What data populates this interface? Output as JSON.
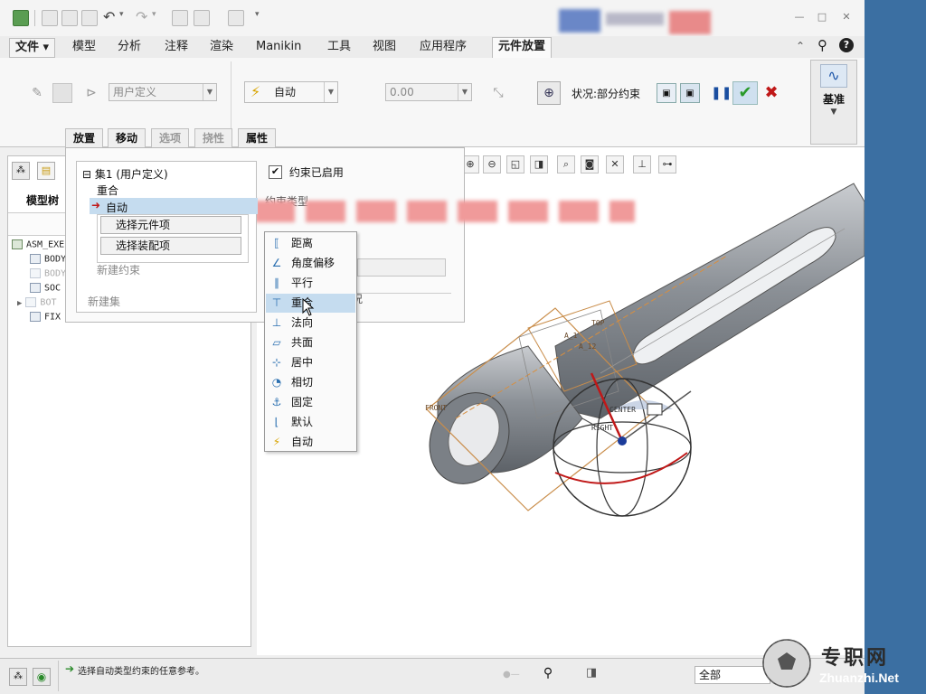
{
  "tabs": [
    {
      "label": "文件 ▾"
    },
    {
      "label": "模型"
    },
    {
      "label": "分析"
    },
    {
      "label": "注释"
    },
    {
      "label": "渲染"
    },
    {
      "label": "Manikin"
    },
    {
      "label": "工具"
    },
    {
      "label": "视图"
    },
    {
      "label": "应用程序"
    },
    {
      "label": "元件放置"
    }
  ],
  "ribbon": {
    "constraint_set_combo": "用户定义",
    "auto_combo": "自动",
    "offset_combo": "0.00",
    "status_text": "状况:部分约束",
    "datum_label": "基准"
  },
  "subtabs": [
    "放置",
    "移动",
    "选项",
    "挠性",
    "属性"
  ],
  "sidebar": {
    "model_tree_label": "模型树",
    "items": [
      "ASM_EXE",
      "BODY",
      "BODY",
      "SOC",
      "BOT",
      "FIX"
    ]
  },
  "placement": {
    "set_label": "⊟ 集1 (用户定义)",
    "coincident": "重合",
    "auto_item": "自动",
    "select_component_btn": "选择元件项",
    "select_assembly_btn": "选择装配项",
    "new_constraint": "新建约束",
    "new_set": "新建集",
    "constraint_enabled": "约束已启用",
    "partial_label_1": "约束类型",
    "partial_label_2": "况"
  },
  "constraint_menu": [
    {
      "label": "距离",
      "icon": "distance-icon"
    },
    {
      "label": "角度偏移",
      "icon": "angle-offset-icon"
    },
    {
      "label": "平行",
      "icon": "parallel-icon"
    },
    {
      "label": "重合",
      "icon": "coincident-icon"
    },
    {
      "label": "法向",
      "icon": "normal-icon"
    },
    {
      "label": "共面",
      "icon": "coplanar-icon"
    },
    {
      "label": "居中",
      "icon": "centered-icon"
    },
    {
      "label": "相切",
      "icon": "tangent-icon"
    },
    {
      "label": "固定",
      "icon": "fix-icon"
    },
    {
      "label": "默认",
      "icon": "default-icon"
    },
    {
      "label": "自动",
      "icon": "auto-icon"
    }
  ],
  "viewport": {
    "labels": [
      "FRONT",
      "TOP",
      "A_12",
      "CENTER",
      "RIGHT",
      "A_1"
    ]
  },
  "status": {
    "message": "选择自动类型约束的任意参考。",
    "filter": "全部"
  },
  "watermark": {
    "cn": "专职网",
    "en": "Zhuanzhi.Net"
  },
  "colors": {
    "selected_row": "#c5dcef",
    "accent_green": "#2a9a2a",
    "accent_red": "#c01818",
    "desktop": "#3b6fa2"
  }
}
